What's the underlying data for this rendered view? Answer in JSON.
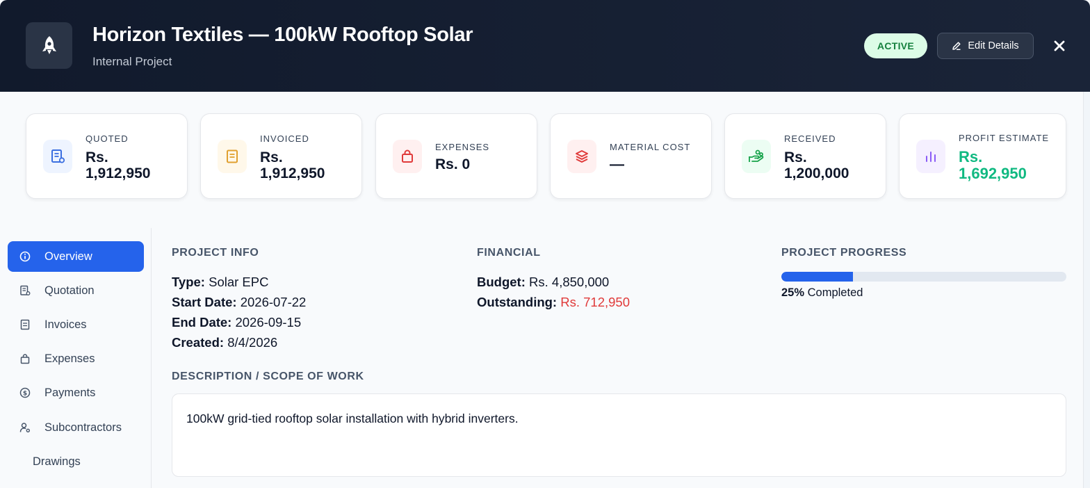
{
  "header": {
    "title": "Horizon Textiles — 100kW Rooftop Solar",
    "subtitle": "Internal Project",
    "logo_icon": "rocket-icon",
    "status": "ACTIVE",
    "edit_label": "Edit Details",
    "close_icon": "close-icon"
  },
  "stats": [
    {
      "label": "QUOTED",
      "value_line1": "Rs.",
      "value_line2": "1,912,950",
      "icon": "quotation-icon",
      "color": "#3b6fe0",
      "bg": "#eef4ff"
    },
    {
      "label": "INVOICED",
      "value_line1": "Rs.",
      "value_line2": "1,912,950",
      "icon": "invoice-icon",
      "color": "#e0a030",
      "bg": "#fff8ea"
    },
    {
      "label": "EXPENSES",
      "value": "Rs. 0",
      "icon": "shopping-bag-icon",
      "color": "#e03a3a",
      "bg": "#fff0f0"
    },
    {
      "label": "MATERIAL COST",
      "value": "—",
      "icon": "layers-icon",
      "color": "#e03a3a",
      "bg": "#fff0f0"
    },
    {
      "label": "RECEIVED",
      "value_line1": "Rs.",
      "value_line2": "1,200,000",
      "icon": "hand-coins-icon",
      "color": "#16a34a",
      "bg": "#ecfdf3"
    },
    {
      "label": "PROFIT ESTIMATE",
      "value_line1": "Rs.",
      "value_line2": "1,692,950",
      "icon": "bar-chart-icon",
      "color": "#8b5cf6",
      "bg": "#f5f0ff",
      "value_color": "#10b981"
    }
  ],
  "sidebar": {
    "items": [
      {
        "label": "Overview",
        "icon": "info-icon",
        "active": true
      },
      {
        "label": "Quotation",
        "icon": "quotation-icon"
      },
      {
        "label": "Invoices",
        "icon": "invoice-icon"
      },
      {
        "label": "Expenses",
        "icon": "shopping-bag-icon"
      },
      {
        "label": "Payments",
        "icon": "dollar-circle-icon"
      },
      {
        "label": "Subcontractors",
        "icon": "user-gear-icon"
      },
      {
        "label": "Drawings",
        "icon": ""
      }
    ]
  },
  "project_info": {
    "title": "PROJECT INFO",
    "type_label": "Type:",
    "type_value": "Solar EPC",
    "start_label": "Start Date:",
    "start_value": "2026-07-22",
    "end_label": "End Date:",
    "end_value": "2026-09-15",
    "created_label": "Created:",
    "created_value": "8/4/2026"
  },
  "financial": {
    "title": "FINANCIAL",
    "budget_label": "Budget:",
    "budget_value": "Rs. 4,850,000",
    "outstanding_label": "Outstanding:",
    "outstanding_value": "Rs. 712,950",
    "outstanding_color": "#e03a3a"
  },
  "progress": {
    "title": "PROJECT PROGRESS",
    "percent": 25,
    "percent_label": "25%",
    "suffix": "Completed"
  },
  "description": {
    "title": "DESCRIPTION / SCOPE OF WORK",
    "text": "100kW grid-tied rooftop solar installation with hybrid inverters."
  },
  "colors": {
    "accent": "#2563eb",
    "header_bg": "#111a2c",
    "active_badge_bg": "#dcfce7",
    "active_badge_text": "#15803d"
  }
}
